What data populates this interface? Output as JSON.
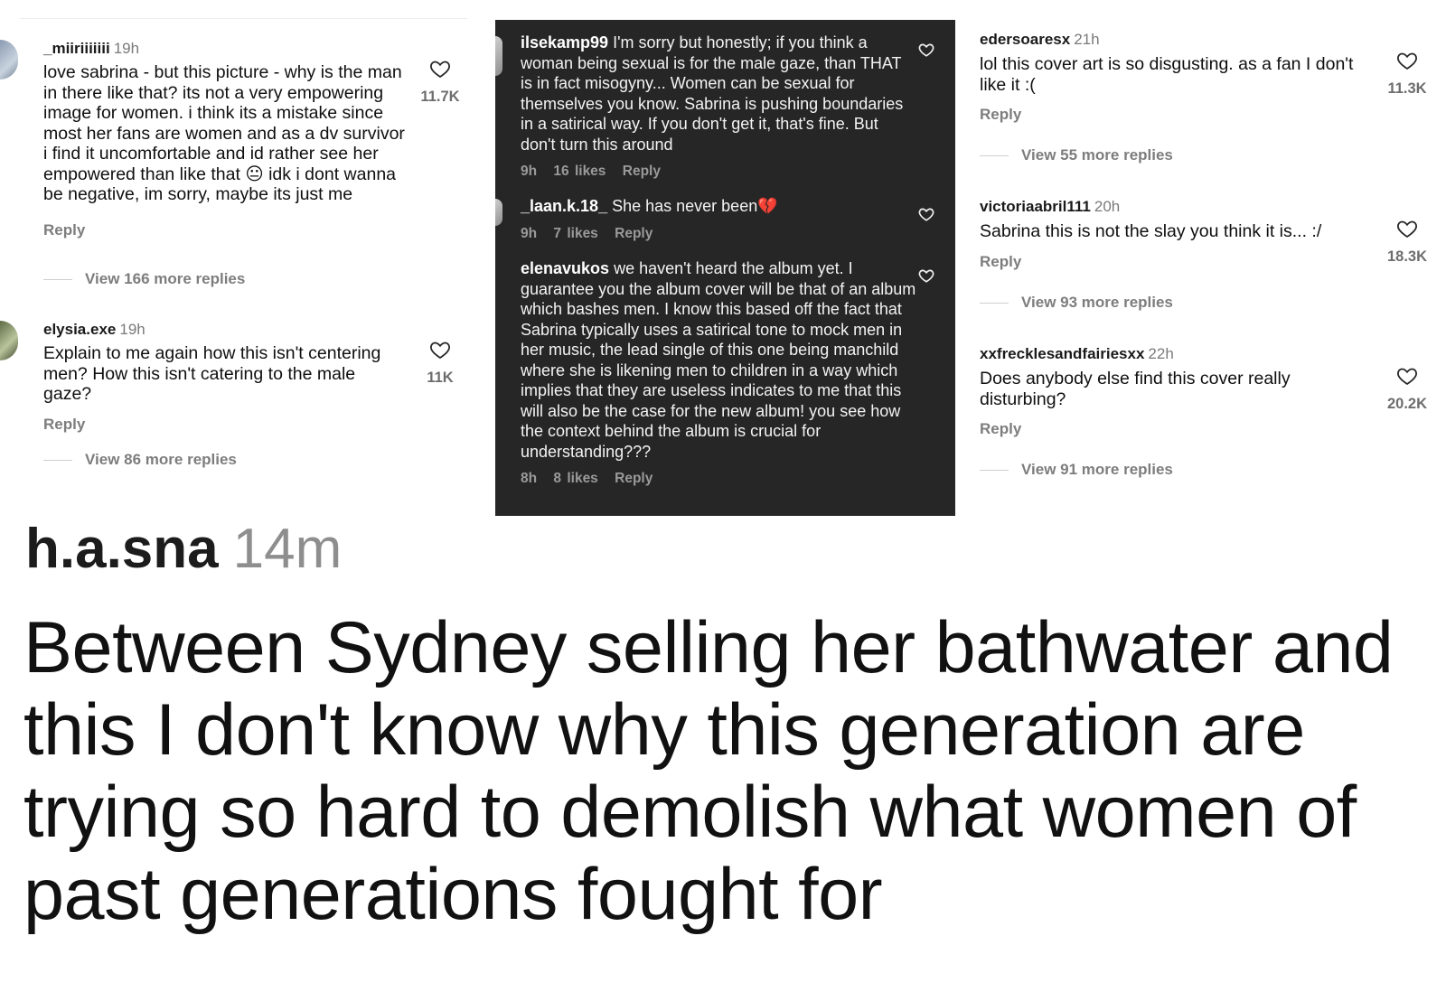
{
  "left_panel": {
    "comments": [
      {
        "username": "_miiriiiiiii",
        "time": "19h",
        "text_before_emoji": "love sabrina - but this picture - why is the man in there like that? its not a very empowering image for women. i think its a mistake since most her fans are women and as a dv survivor i find it uncomfortable and id rather see her empowered than like that",
        "emoji": "😐",
        "text_after_emoji": "idk i dont wanna be negative, im sorry, maybe its just me",
        "reply_label": "Reply",
        "view_replies": "View 166 more replies",
        "likes": "11.7K"
      },
      {
        "username": "elysia.exe",
        "time": "19h",
        "text": "Explain to me again how this isn't centering men? How this isn't catering to the male gaze?",
        "reply_label": "Reply",
        "view_replies": "View 86 more replies",
        "likes": "11K"
      }
    ]
  },
  "middle_panel": {
    "comments": [
      {
        "username": "ilsekamp99",
        "text": "I'm sorry but honestly; if you think a woman being sexual is for the male gaze, than THAT is in fact misogyny... Women can be sexual for themselves you know. Sabrina is pushing boundaries in a satirical way. If you don't get it, that's fine. But don't turn this around",
        "time": "9h",
        "likes": "16 likes",
        "reply_label": "Reply"
      },
      {
        "username": "_laan.k.18_",
        "text": "She has never been",
        "emoji": "💔",
        "time": "9h",
        "likes": "7 likes",
        "reply_label": "Reply"
      },
      {
        "username": "elenavukos",
        "text": "we haven't heard the album yet. I guarantee you the album cover will be that of an album which bashes men. I know this based off the fact that Sabrina typically uses a satirical tone to mock men in her music, the lead single of this one being manchild where she is likening men to children in a way which implies that they are useless indicates to me that this will also be the case for the new album! you see how the context behind the album is crucial for understanding???",
        "time": "8h",
        "likes": "8 likes",
        "reply_label": "Reply"
      }
    ]
  },
  "right_panel": {
    "comments": [
      {
        "username": "edersoaresx",
        "time": "21h",
        "text": "lol this cover art is so disgusting. as a fan I don't like it :(",
        "reply_label": "Reply",
        "view_replies": "View 55 more replies",
        "likes": "11.3K"
      },
      {
        "username": "victoriaabril111",
        "time": "20h",
        "text": "Sabrina this is not the slay you think it is... :/",
        "reply_label": "Reply",
        "view_replies": "View 93 more replies",
        "likes": "18.3K"
      },
      {
        "username": "xxfrecklesandfairiesxx",
        "time": "22h",
        "text": "Does anybody else find this cover really disturbing?",
        "reply_label": "Reply",
        "view_replies": "View 91 more replies",
        "likes": "20.2K"
      }
    ]
  },
  "tweet": {
    "username": "h.a.sna",
    "time": "14m",
    "text": "Between Sydney selling her bathwater and this I don't know why this generation are trying so hard to demolish what women of past generations fought for"
  },
  "icons": {
    "heart": "heart-outline-icon"
  },
  "colors": {
    "dark_panel_bg": "#262626",
    "muted_text": "#7d7d7d"
  }
}
